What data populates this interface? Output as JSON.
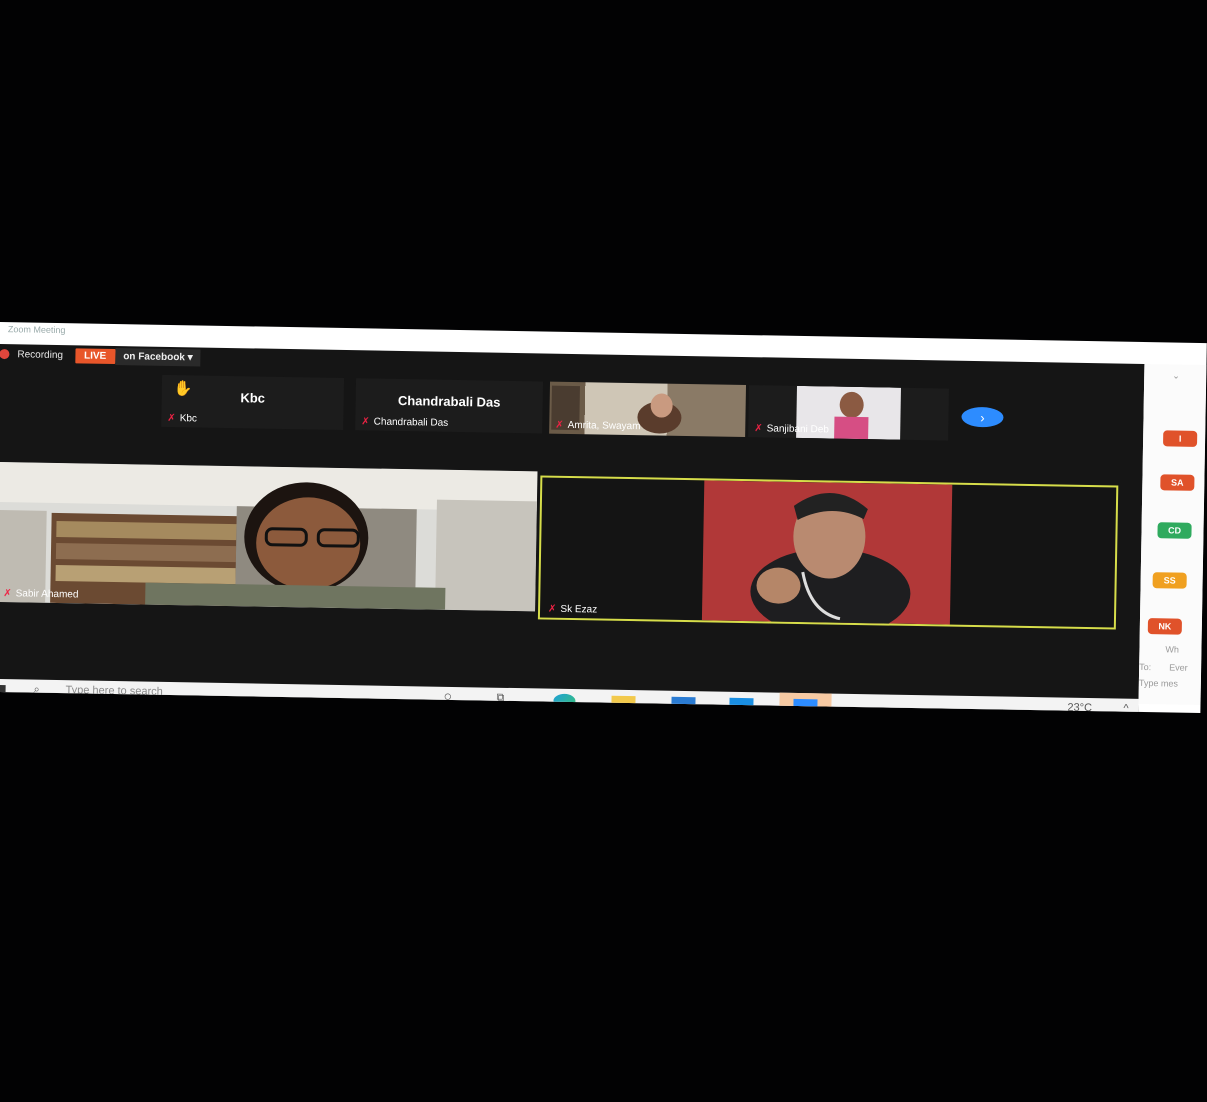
{
  "window": {
    "title": "Zoom Meeting"
  },
  "recording": {
    "label": "Recording",
    "live_badge": "LIVE",
    "destination": "on Facebook",
    "dropdown_arrow": "▾"
  },
  "strip": [
    {
      "big_name": "Kbc",
      "label": "Kbc",
      "raised_hand": "✋"
    },
    {
      "big_name": "Chandrabali Das",
      "label": "Chandrabali Das"
    },
    {
      "label": "Amrita, Swayam"
    },
    {
      "label": "Sanjibani Deb"
    }
  ],
  "next_page": "›",
  "videos": [
    {
      "name": "Sabir Ahamed"
    },
    {
      "name": "Sk Ezaz"
    }
  ],
  "mic_icon": "✗",
  "taskbar": {
    "search_placeholder": "Type here to search",
    "search_glyph": "⌕",
    "cortana_glyph": "○",
    "taskview_glyph": "⧉",
    "temperature": "23°C",
    "tray_caret": "^"
  },
  "participants_panel": {
    "avatars": [
      {
        "initials": "I",
        "color": "#e0522a"
      },
      {
        "initials": "SA",
        "color": "#e0522a"
      },
      {
        "initials": "CD",
        "color": "#2faa5e"
      },
      {
        "initials": "SS",
        "color": "#f0a020"
      },
      {
        "initials": "NK",
        "color": "#e0522a"
      }
    ],
    "chat_to_label": "To:",
    "chat_to_value": "Ever",
    "chat_placeholder": "Type mes",
    "who_label": "Wh",
    "chevron": "⌄"
  }
}
